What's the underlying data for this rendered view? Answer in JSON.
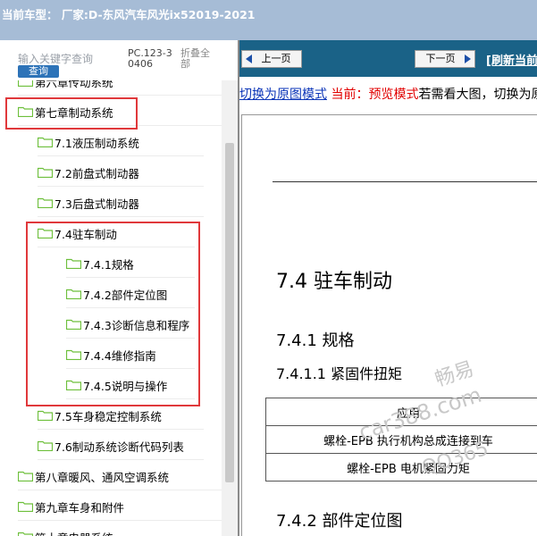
{
  "window": {
    "title": "当前车型：  厂家:D-东风汽车风光ix52019-2021"
  },
  "sidebar": {
    "search_placeholder": "输入关键字查询",
    "search_button": "查询",
    "code": "PC.123-30406",
    "collapse_all": "折叠全部",
    "tree": [
      {
        "label": "第六章传动系统"
      },
      {
        "label": "第七章制动系统"
      },
      {
        "label": "7.1液压制动系统"
      },
      {
        "label": "7.2前盘式制动器"
      },
      {
        "label": "7.3后盘式制动器"
      },
      {
        "label": "7.4驻车制动"
      },
      {
        "label": "7.4.1规格"
      },
      {
        "label": "7.4.2部件定位图"
      },
      {
        "label": "7.4.3诊断信息和程序"
      },
      {
        "label": "7.4.4维修指南"
      },
      {
        "label": "7.4.5说明与操作"
      },
      {
        "label": "7.5车身稳定控制系统"
      },
      {
        "label": "7.6制动系统诊断代码列表"
      },
      {
        "label": "第八章暖风、通风空调系统"
      },
      {
        "label": "第九章车身和附件"
      },
      {
        "label": "第十章电器系统"
      }
    ]
  },
  "content": {
    "prev_button": "上一页",
    "next_button": "下一页",
    "refresh_link": "[刷新当前页]",
    "mode": {
      "switch_link": "切换为原图模式",
      "current_label": "当前：",
      "current_mode": "预览模式",
      "hint": "若需看大图，切换为原图模式"
    },
    "document": {
      "section_title": "7.4 驻车制动",
      "subsection": "7.4.1 规格",
      "subsubsection": "7.4.1.1 紧固件扭矩",
      "table_header": "应用",
      "table_rows": [
        "螺栓-EPB 执行机构总成连接到车",
        "螺栓-EPB 电机紧固力矩"
      ],
      "next_section": "7.4.2 部件定位图"
    },
    "watermarks": [
      "畅易",
      "car388.com",
      "QQ365"
    ]
  },
  "colors": {
    "titlebar": "#a6bcd6",
    "navbar": "#1a6287",
    "highlight_box": "#e0383b",
    "folder": "#6dbf3b",
    "link": "#0b35b8",
    "mode_red": "#e10000"
  }
}
